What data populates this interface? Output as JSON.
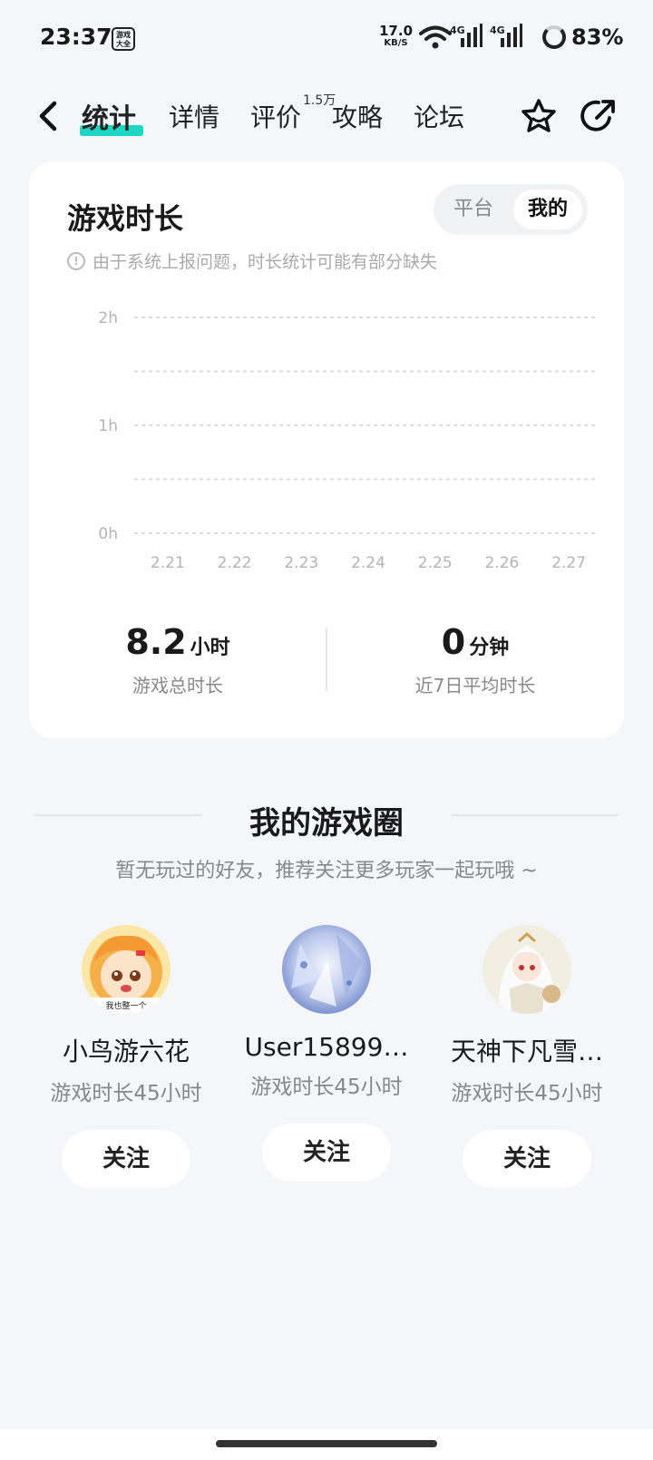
{
  "status_bar": {
    "time": "23:37",
    "app_icon_text": "游戏大全",
    "speed": "17.0",
    "speed_unit": "KB/S",
    "net1": "4G",
    "net2": "4G",
    "battery": "83%"
  },
  "nav": {
    "tabs": [
      {
        "label": "统计",
        "active": true
      },
      {
        "label": "详情",
        "active": false
      },
      {
        "label": "评价",
        "active": false
      },
      {
        "label": "攻略",
        "active": false
      },
      {
        "label": "论坛",
        "active": false
      }
    ],
    "review_badge": "1.5万",
    "accent": "#1ed6c3"
  },
  "playtime_card": {
    "title": "游戏时长",
    "segments": [
      {
        "label": "平台",
        "active": false
      },
      {
        "label": "我的",
        "active": true
      }
    ],
    "notice": "由于系统上报问题，时长统计可能有部分缺失",
    "total": {
      "value": "8.2",
      "unit": "小时",
      "label": "游戏总时长"
    },
    "average": {
      "value": "0",
      "unit": "分钟",
      "label": "近7日平均时长"
    }
  },
  "chart_data": {
    "type": "bar",
    "categories": [
      "2.21",
      "2.22",
      "2.23",
      "2.24",
      "2.25",
      "2.26",
      "2.27"
    ],
    "values": [
      0,
      0,
      0,
      0,
      0,
      0,
      0
    ],
    "y_ticks": [
      "0h",
      "1h",
      "2h"
    ],
    "ylim": [
      0,
      2
    ],
    "grid": true
  },
  "circle": {
    "title": "我的游戏圈",
    "subtitle": "暂无玩过的好友，推荐关注更多玩家一起玩哦 ~",
    "friends": [
      {
        "name": "小鸟游六花",
        "playtime": "游戏时长45小时",
        "follow_label": "关注",
        "avatar_icon": "anime-girl-avatar",
        "avatar_caption": "我也整一个"
      },
      {
        "name": "User15899…",
        "playtime": "游戏时长45小时",
        "follow_label": "关注",
        "avatar_icon": "crystal-avatar"
      },
      {
        "name": "天神下凡雪…",
        "playtime": "游戏时长45小时",
        "follow_label": "关注",
        "avatar_icon": "white-hair-avatar"
      }
    ]
  }
}
